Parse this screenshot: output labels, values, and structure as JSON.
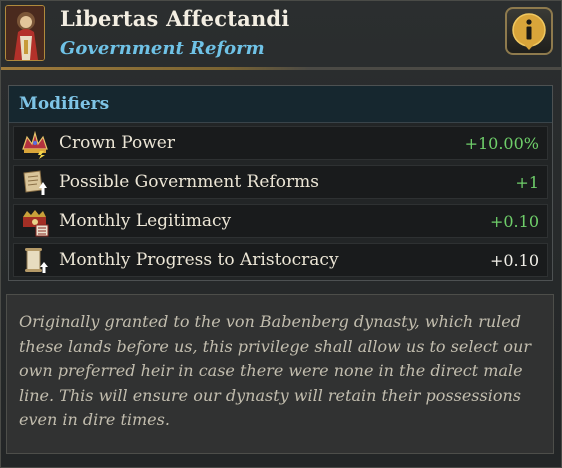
{
  "header": {
    "title": "Libertas Affectandi",
    "subtitle": "Government Reform",
    "portrait_icon": "saint-portrait-icon",
    "info_icon": "info-icon"
  },
  "modifiers": {
    "title": "Modifiers",
    "rows": [
      {
        "icon": "crown-power-icon",
        "label": "Crown Power",
        "value": "+10.00%",
        "value_color": "#6fcf6a"
      },
      {
        "icon": "government-reforms-icon",
        "label": "Possible Government Reforms",
        "value": "+1",
        "value_color": "#6fcf6a"
      },
      {
        "icon": "legitimacy-icon",
        "label": "Monthly Legitimacy",
        "value": "+0.10",
        "value_color": "#6fcf6a"
      },
      {
        "icon": "aristocracy-scroll-icon",
        "label": "Monthly Progress to Aristocracy",
        "value": "+0.10",
        "value_color": "#f1efe8"
      }
    ]
  },
  "description": "Originally granted to the von Babenberg dynasty, which ruled these lands before us, this privilege shall allow us to select our own preferred heir in case there were none in the direct male line. This will ensure our dynasty will retain their possessions even in dire times."
}
